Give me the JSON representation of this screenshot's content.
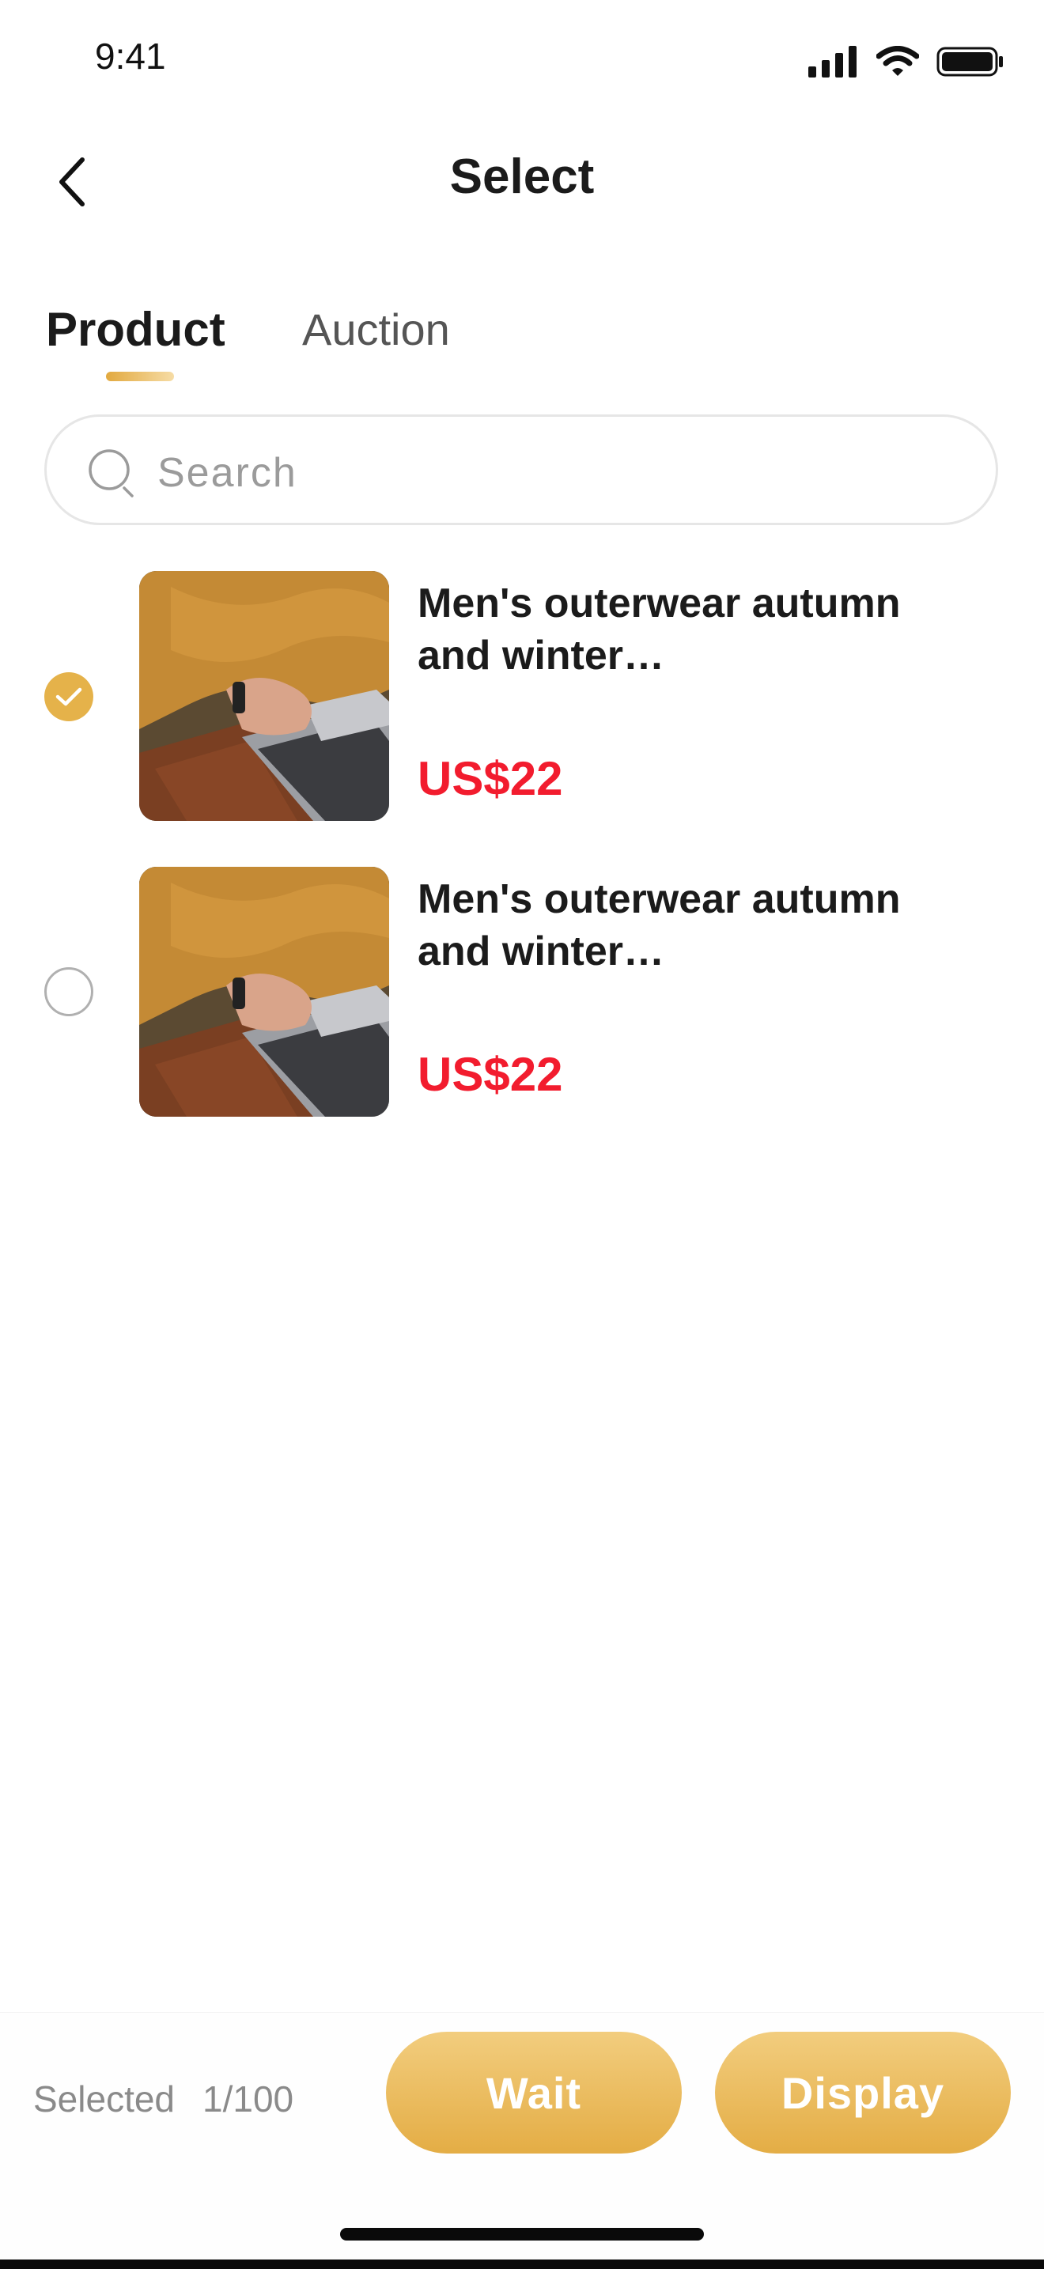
{
  "status_bar": {
    "time": "9:41",
    "icons": [
      "signal-icon",
      "wifi-icon",
      "battery-icon"
    ]
  },
  "header": {
    "title": "Select",
    "back_icon": "chevron-left-icon"
  },
  "tabs": [
    {
      "label": "Product",
      "active": true
    },
    {
      "label": "Auction",
      "active": false
    }
  ],
  "search": {
    "placeholder": "Search",
    "value": "",
    "icon": "search-icon"
  },
  "products": [
    {
      "name_line1": "Men's outerwear autumn",
      "name_line2": "and winter…",
      "price": "US$22",
      "selected": true
    },
    {
      "name_line1": "Men's outerwear autumn",
      "name_line2": "and winter…",
      "price": "US$22",
      "selected": false
    }
  ],
  "footer": {
    "selected_label": "Selected",
    "selected_count": "1/100",
    "wait_label": "Wait",
    "display_label": "Display"
  },
  "colors": {
    "accent": "#e5b24a",
    "price": "#f21c2e",
    "text": "#1b1b1b",
    "muted": "#8a8a8a"
  }
}
